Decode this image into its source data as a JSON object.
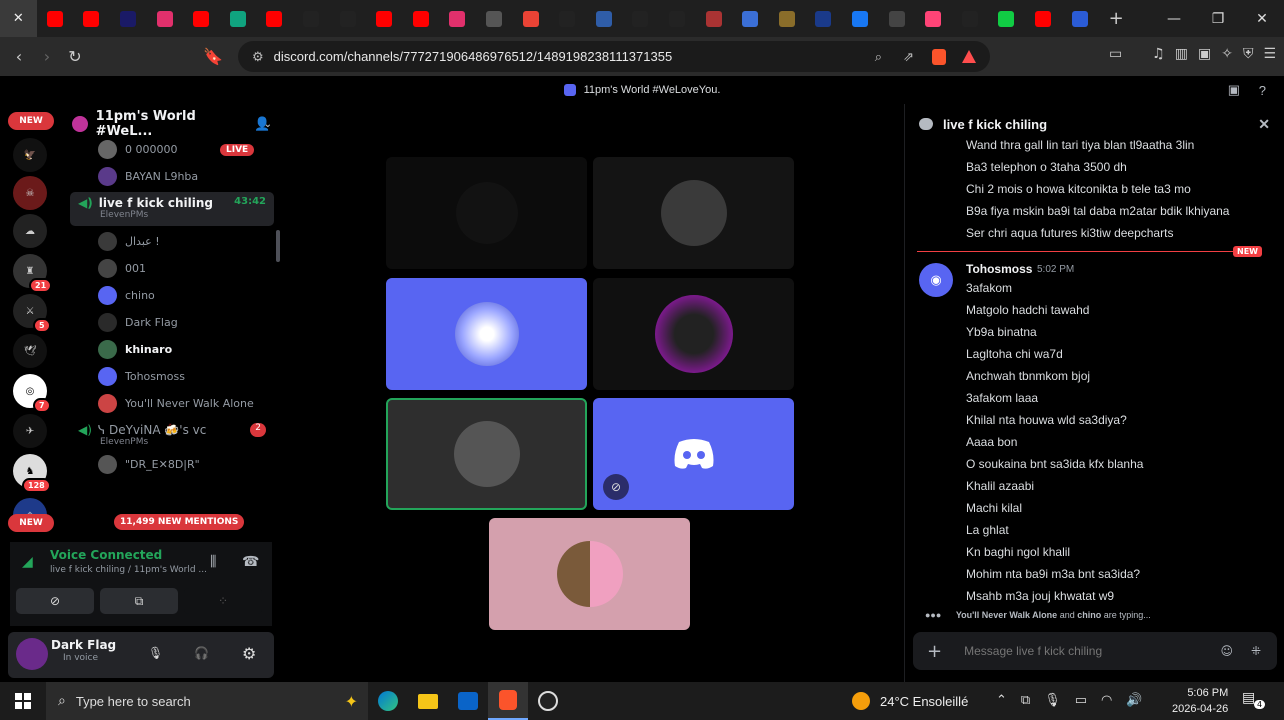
{
  "browser": {
    "url": "discord.com/channels/777271906486976512/1489198238111371355",
    "tab_colors": [
      "#3a3a3a",
      "#ff0000",
      "#ff0000",
      "#1a1a66",
      "#e1306c",
      "#ff0000",
      "#10a37f",
      "#ff0000",
      "#222222",
      "#222222",
      "#ff0000",
      "#ff0000",
      "#e1306c",
      "#555555",
      "#ea4335",
      "#222222",
      "#2f5da8",
      "#222222",
      "#222222",
      "#aa3333",
      "#3b6fd6",
      "#8a6d2a",
      "#1a3a8a",
      "#1877f2",
      "#444444",
      "#ff4477",
      "#222222",
      "#11cc44",
      "#ff0000",
      "#2b5cd6"
    ],
    "new_tab_icon": "plus-icon"
  },
  "topbar": {
    "title": "11pm's World #WeLoveYou."
  },
  "servers": {
    "new_top": "NEW",
    "new_bottom": "NEW",
    "badges": [
      "21",
      "5",
      "7",
      "128"
    ]
  },
  "sidebar": {
    "server_name": "11pm's World #WeL...",
    "top_rows": [
      {
        "name": "0 000000",
        "live": "LIVE"
      },
      {
        "name": "BAYAN L9hba"
      }
    ],
    "channel": {
      "name": "live f kick chiling",
      "timer": "43:42",
      "sub": "ElevenPMs"
    },
    "members": [
      "عبدال !",
      "001",
      "chino",
      "Dark Flag",
      "khinaro",
      "Tohosmoss",
      "You'll Never Walk Alone"
    ],
    "channel2": {
      "name": "ᓭ DeYviNA 🍻's vc",
      "count": "2",
      "sub": "ElevenPMs"
    },
    "member2": "\"DR_E✕8D|R\"",
    "mentions_pill": "11,499 NEW MENTIONS"
  },
  "voice": {
    "status": "Voice Connected",
    "location": "live f kick chiling / 11pm's World ..."
  },
  "user": {
    "name": "Dark Flag",
    "status": "In voice"
  },
  "chat": {
    "channel_name": "live f kick chiling",
    "earlier_messages": [
      "Wand thra gall lin tari tiya blan tl9aatha 3lin",
      "Ba3 telephon o 3taha 3500 dh",
      "Chi 2 mois o howa kitconikta b tele ta3 mo",
      "B9a fiya mskin ba9i tal daba m2atar bdik lkhiyana",
      "Ser chri aqua futures ki3tiw deepcharts"
    ],
    "new_divider": "NEW",
    "author": "Tohosmoss",
    "time": "5:02 PM",
    "messages": [
      "3afakom",
      "Matgolo hadchi tawahd",
      "Yb9a binatna",
      "Lagltoha chi wa7d",
      "Anchwah tbnmkom bjoj",
      "3afakom laaa",
      "Khilal nta houwa wld sa3diya?",
      "Aaaa bon",
      "O soukaina bnt sa3ida kfx blanha",
      "Khalil azaabi",
      "Machi kilal",
      "La ghlat",
      "Kn baghi ngol khalil",
      "Mohim nta ba9i m3a bnt sa3ida?",
      "Msahb m3a jouj khwatat w9"
    ],
    "typing_name1": "You'll Never Walk Alone",
    "typing_and": "and",
    "typing_name2": "chino",
    "typing_suffix": "are typing...",
    "placeholder": "Message live f kick chiling"
  },
  "taskbar": {
    "search_placeholder": "Type here to search",
    "weather": "24°C Ensoleillé",
    "time": "5:06 PM",
    "date": "2026-04-26",
    "notif_count": "4"
  }
}
